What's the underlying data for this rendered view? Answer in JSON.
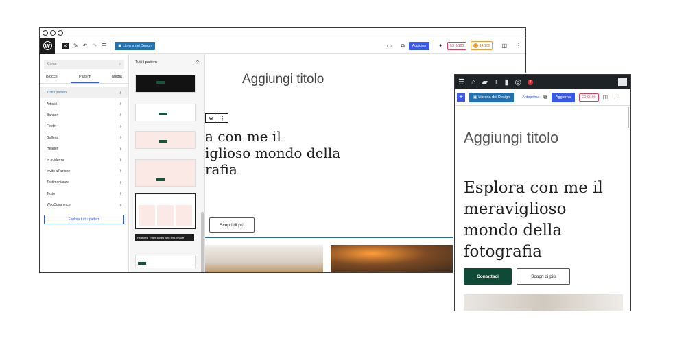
{
  "desktop": {
    "toolbar": {
      "library_label": "Libreria dei Design",
      "update_label": "Aggiorna",
      "seo_score": "0/100",
      "readability_score": "14/100"
    },
    "sidebar": {
      "search_placeholder": "Cerca",
      "tabs": [
        "Blocchi",
        "Pattern",
        "Media"
      ],
      "categories": [
        "Tutti i pattern",
        "Articoli",
        "Banner",
        "Footer",
        "Galleria",
        "Header",
        "In evidenza",
        "Invito all'azione",
        "Testimonianze",
        "Testo",
        "WooCommerce"
      ],
      "explore_label": "Esplora tutti i pattern"
    },
    "patterns_panel": {
      "title": "Tutti i pattern",
      "tooltip": "Featured Three boxes with text, image"
    },
    "canvas": {
      "title": "Aggiungi titolo",
      "heading": "a con me il\niglioso mondo della\nrafia",
      "more_button": "Scopri di più"
    }
  },
  "mobile": {
    "toolbar": {
      "library_label": "Libreria dei Design",
      "preview_label": "Anteprima",
      "update_label": "Aggiorna",
      "seo_score": "0/100"
    },
    "admin_bar": {
      "notifications": "7"
    },
    "canvas": {
      "title": "Aggiungi titolo",
      "heading": "Esplora con me il meraviglioso mondo della fotografia",
      "contact_button": "Contattaci",
      "more_button": "Scopri di più"
    }
  },
  "colors": {
    "wp_blue": "#3858e9",
    "library_blue": "#2271b1",
    "dark_green": "#0f4a36",
    "admin_bar": "#1d2327",
    "seo_red": "#e03b5b",
    "readability_orange": "#f0a033"
  },
  "icons": [
    "wordpress-logo-icon",
    "close-icon",
    "pen-icon",
    "undo-icon",
    "redo-icon",
    "list-view-icon",
    "desktop-icon",
    "external-link-icon",
    "sparkle-icon",
    "sidebar-toggle-icon",
    "more-vertical-icon",
    "search-icon",
    "chevron-right-icon",
    "filter-icon",
    "menu-icon",
    "home-icon",
    "comment-icon",
    "plus-icon",
    "stats-icon",
    "notification-icon",
    "avatar-icon"
  ]
}
